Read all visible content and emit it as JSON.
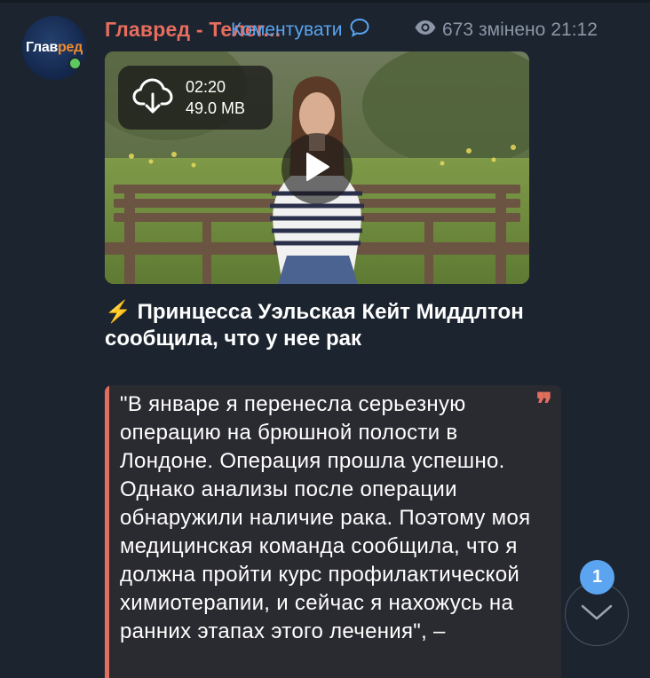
{
  "channel": {
    "avatar_logo_white": "Глав",
    "avatar_logo_orange": "ред",
    "name": "Главред - Телег..."
  },
  "post": {
    "comments_label": "Коментувати",
    "views": "673",
    "edited_label": "змінено",
    "time": "21:12",
    "video": {
      "duration": "02:20",
      "size": "49.0 MB"
    },
    "headline_icon": "⚡️",
    "headline": "Принцесса Уэльская Кейт Миддлтон сообщила, что у нее рак",
    "quote": "\"В январе я перенесла серьезную операцию на брюшной полости в Лондоне. Операция прошла успешно. Однако анализы после операции обнаружили наличие рака. Поэтому моя медицинская команда сообщила, что я должна пройти курс профилактической химиотерапии, и сейчас я нахожусь на ранних этапах этого лечения\", –"
  },
  "scroll": {
    "unread_count": "1"
  },
  "colors": {
    "background": "#1c242f",
    "accent_blue": "#5aa4f0",
    "channel_name": "#e76d5e",
    "quote_bar": "#e06f5e",
    "online": "#5cc95f"
  },
  "icons": [
    "cloud-download-icon",
    "play-icon",
    "eye-icon",
    "comment-icon",
    "chevron-down-icon",
    "lightning-icon",
    "quote-mark-icon"
  ]
}
